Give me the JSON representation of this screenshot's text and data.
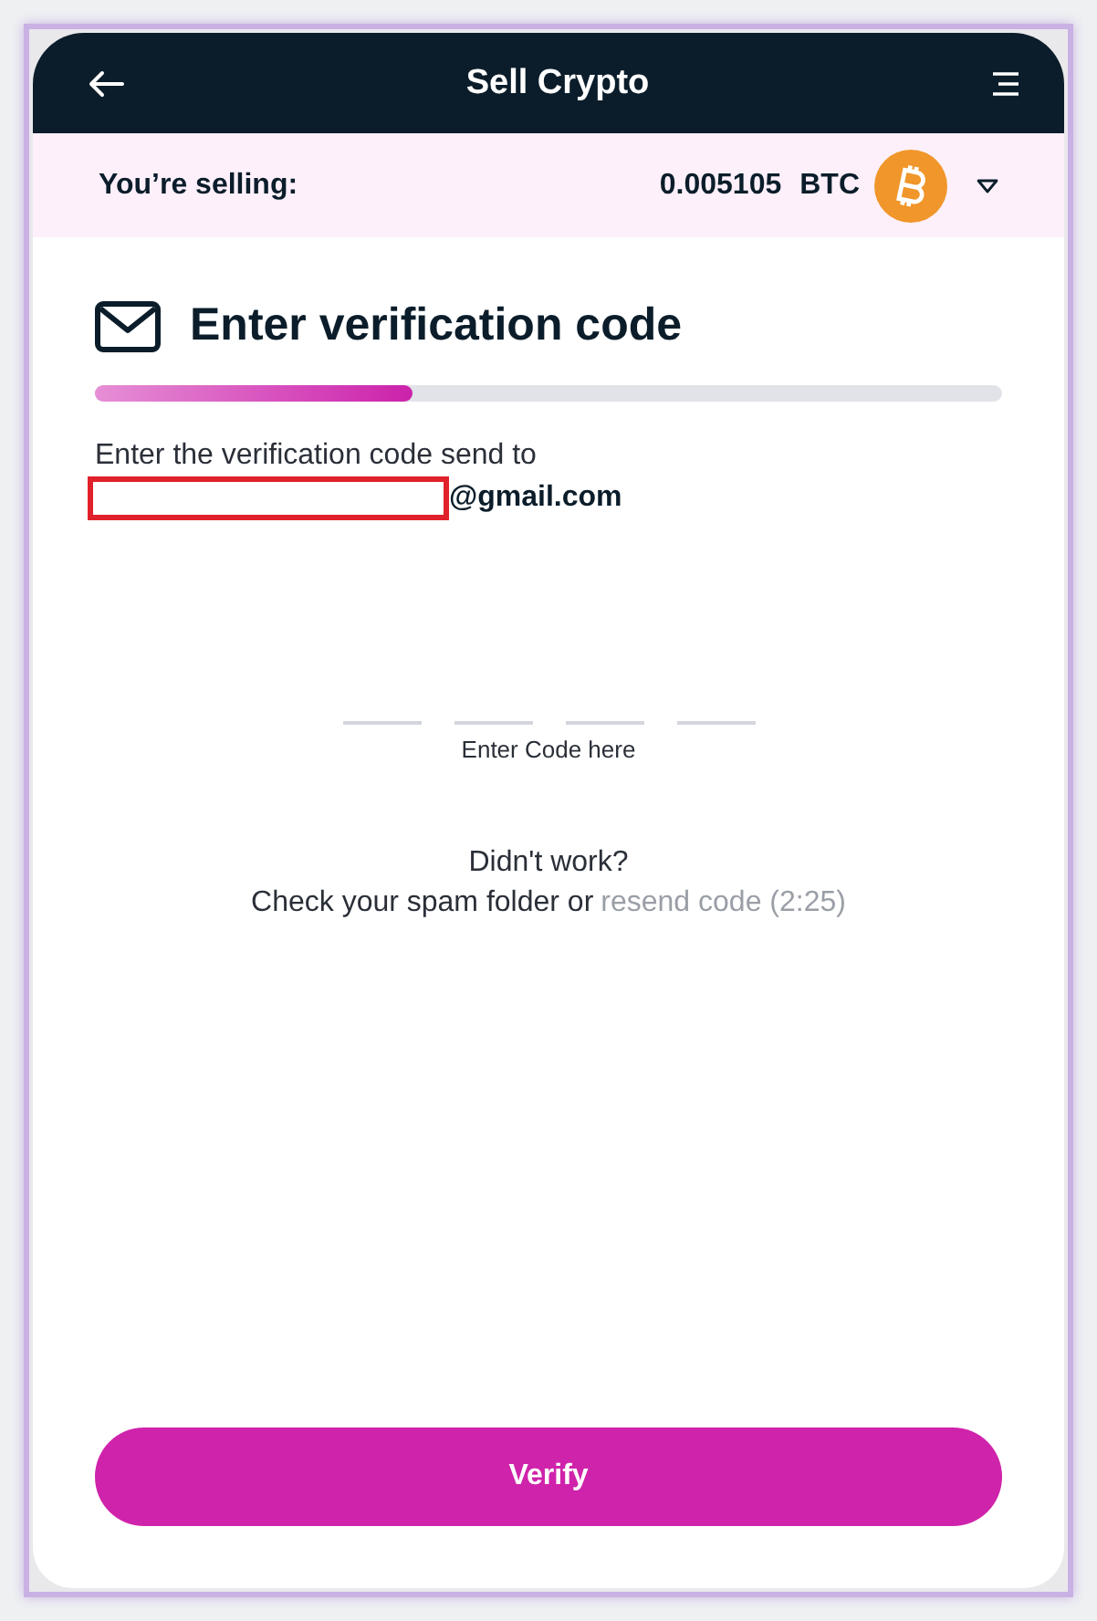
{
  "header": {
    "title": "Sell Crypto"
  },
  "selling": {
    "label": "You’re selling:",
    "amount": "0.005105",
    "currency": "BTC"
  },
  "step": {
    "title": "Enter verification code",
    "level": 0.35
  },
  "message": {
    "text": "Enter the verification code send to",
    "email_suffix": "@gmail.com"
  },
  "code_inputs": [
    {
      "filled": false
    },
    {
      "filled": false
    },
    {
      "filled": false
    },
    {
      "filled": false
    }
  ],
  "code_hint": "Enter Code here",
  "help": {
    "question": "Didn't work?",
    "text": "Check your spam folder or",
    "link": "resend code (2:25)",
    "link_disabled": true
  },
  "verify_button": "Verify"
}
